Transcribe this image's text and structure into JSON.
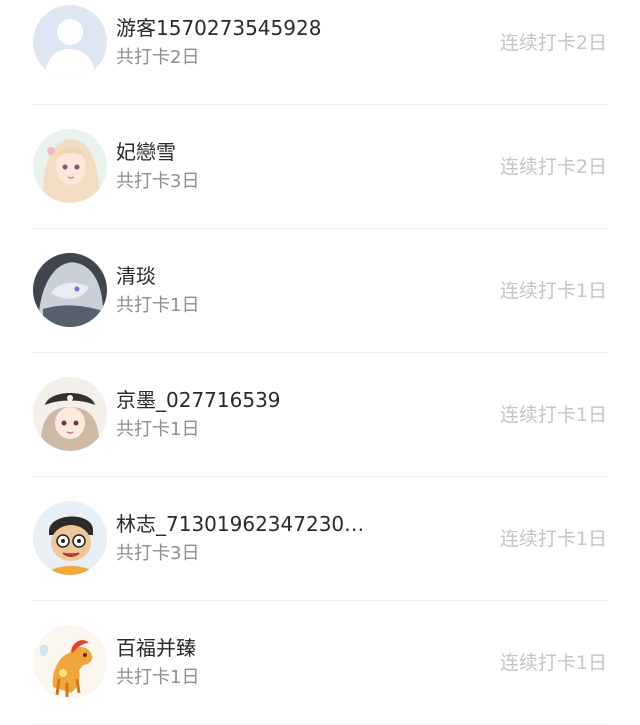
{
  "checkins": [
    {
      "name": "游客1570273545928",
      "total": "共打卡2日",
      "streak": "连续打卡2日",
      "avatar": "default-user-avatar"
    },
    {
      "name": "妃戀雪",
      "total": "共打卡3日",
      "streak": "连续打卡2日",
      "avatar": "anime-girl-avatar"
    },
    {
      "name": "清琰",
      "total": "共打卡1日",
      "streak": "连续打卡1日",
      "avatar": "white-hair-anime-avatar"
    },
    {
      "name": "京墨_027716539",
      "total": "共打卡1日",
      "streak": "连续打卡1日",
      "avatar": "pirate-hat-girl-avatar"
    },
    {
      "name": "林志_713019623472306...",
      "total": "共打卡3日",
      "streak": "连续打卡1日",
      "avatar": "cartoon-boy-avatar"
    },
    {
      "name": "百福并臻",
      "total": "共打卡1日",
      "streak": "连续打卡1日",
      "avatar": "golden-horse-avatar"
    }
  ]
}
